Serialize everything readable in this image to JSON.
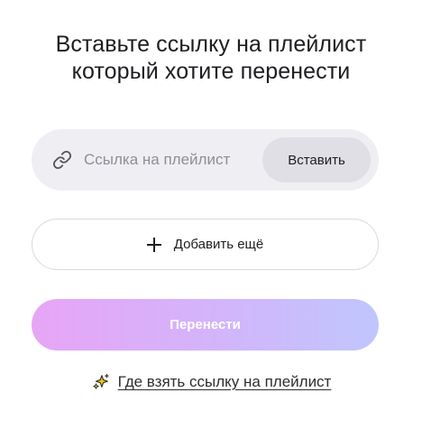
{
  "header": {
    "title_line1": "Вставьте ссылку на плейлист",
    "title_line2": "который хотите перенести"
  },
  "link_field": {
    "icon": "link-icon",
    "placeholder": "Ссылка на плейлист",
    "value": "",
    "paste_label": "Вставить"
  },
  "add_more": {
    "icon": "plus-icon",
    "label": "Добавить ещё"
  },
  "transfer": {
    "label": "Перенести",
    "gradient_start": "#e7a5f6",
    "gradient_end": "#c0c6fd"
  },
  "help": {
    "icon": "sparkle-icon",
    "label": "Где взять ссылку на плейлист"
  }
}
